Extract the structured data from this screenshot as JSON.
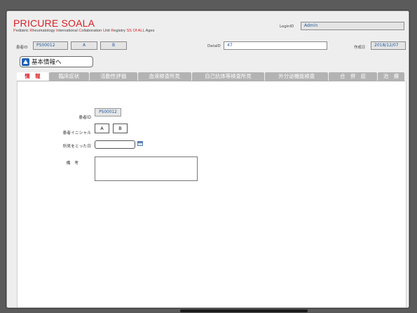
{
  "header": {
    "title": "PRICURE SOALA",
    "subtitle_parts": [
      {
        "text": "P",
        "hl": true
      },
      {
        "text": "ediatric ",
        "hl": false
      },
      {
        "text": "R",
        "hl": true
      },
      {
        "text": "heumatology ",
        "hl": false
      },
      {
        "text": "I",
        "hl": true
      },
      {
        "text": "nternational ",
        "hl": false
      },
      {
        "text": "C",
        "hl": true
      },
      {
        "text": "ollaboration ",
        "hl": false
      },
      {
        "text": "U",
        "hl": true
      },
      {
        "text": "nit ",
        "hl": false
      },
      {
        "text": "R",
        "hl": true
      },
      {
        "text": "egistry ",
        "hl": false
      },
      {
        "text": "SS Of ALL",
        "hl": true
      },
      {
        "text": " Ages",
        "hl": false
      }
    ],
    "login_label": "LoginID",
    "login_value": "Admin"
  },
  "patient_bar": {
    "patient_id_label": "患者ID",
    "patient_id_value": "PS00012",
    "initial_1": "A",
    "initial_2": "B",
    "dataid_label": "DataID",
    "dataid_value": "47",
    "created_label": "作成日",
    "created_value": "2018/12/07"
  },
  "back_button": {
    "label": "基本情報へ",
    "icon": "up-triangle-icon"
  },
  "tabs": [
    {
      "label": "情　報",
      "active": true
    },
    {
      "label": "臨床症状",
      "active": false
    },
    {
      "label": "活動性評価",
      "active": false
    },
    {
      "label": "血液検査所見",
      "active": false
    },
    {
      "label": "自己抗体等検査所見",
      "active": false
    },
    {
      "label": "外分泌機能検査",
      "active": false
    },
    {
      "label": "合　併　症",
      "active": false
    },
    {
      "label": "治　療",
      "active": false
    }
  ],
  "form": {
    "patient_id_label": "患者ID",
    "patient_id_value": "PS00012",
    "initials_label": "患者イニシャル",
    "initial_1": "A",
    "initial_2": "B",
    "finding_date_label": "所見をとった日",
    "finding_date_value": "",
    "remarks_label": "備　考",
    "remarks_value": ""
  },
  "colors": {
    "brand_red": "#d81f26",
    "tab_grey": "#b3b3b3",
    "icon_blue": "#1f61b3"
  }
}
